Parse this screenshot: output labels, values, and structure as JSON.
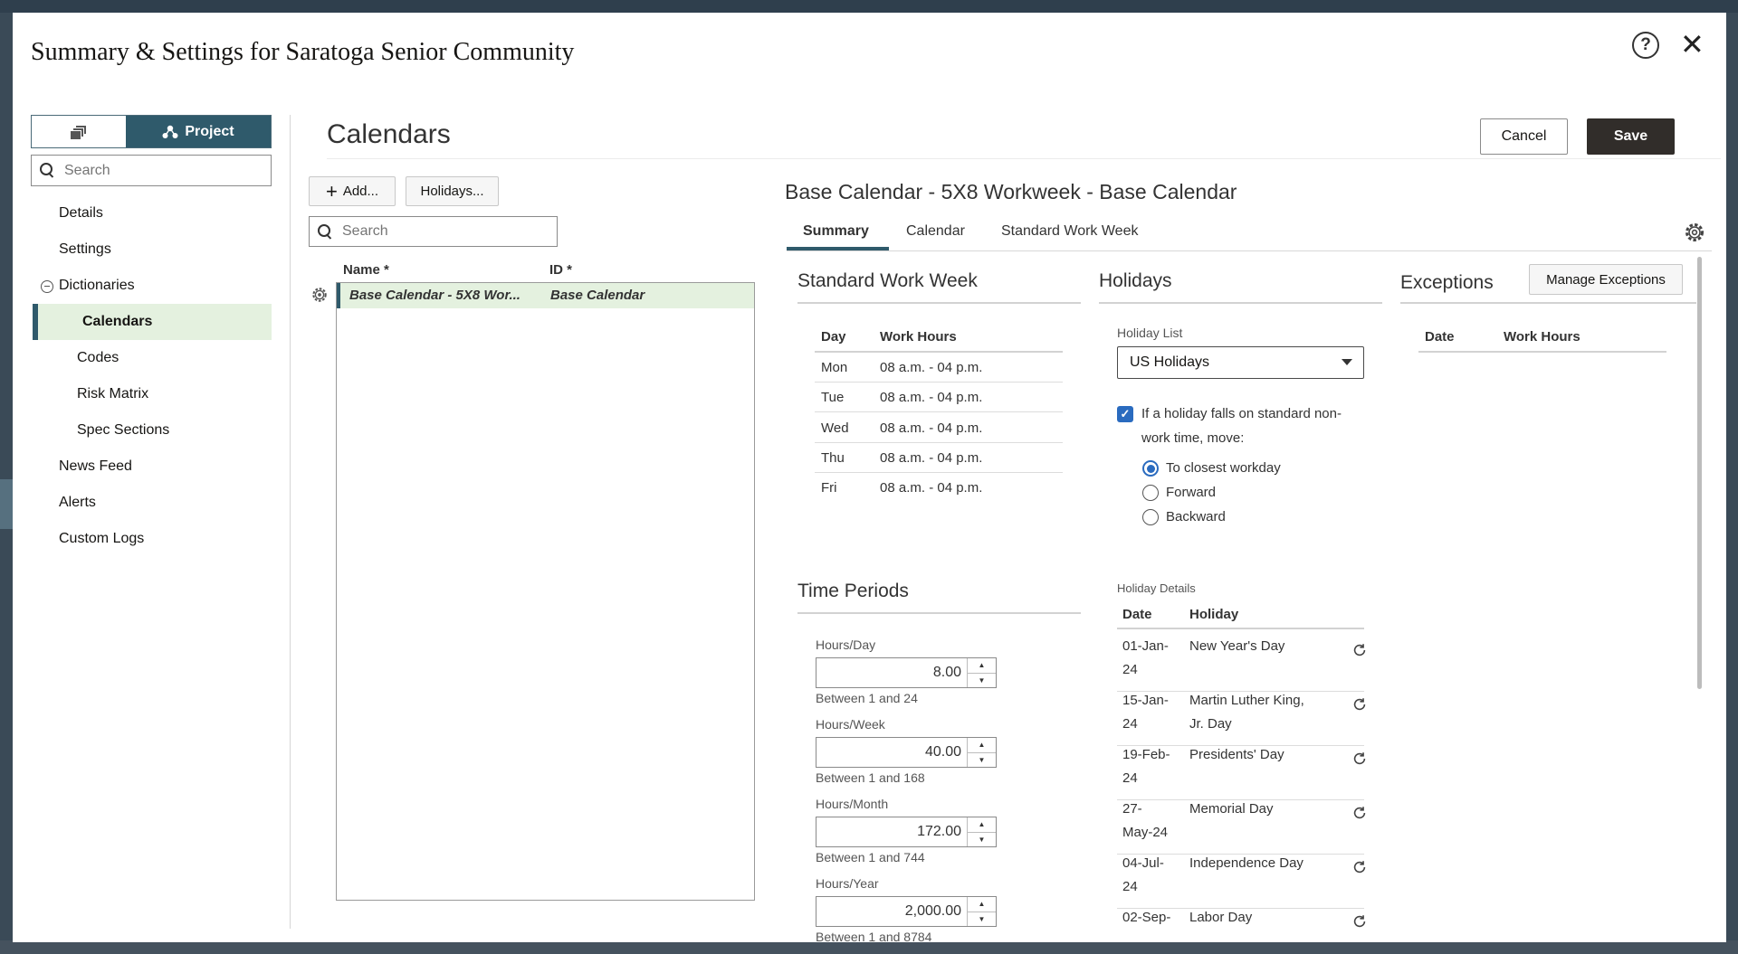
{
  "dialog": {
    "title": "Summary & Settings for Saratoga Senior Community"
  },
  "nav": {
    "toggle_project_label": "Project",
    "search_placeholder": "Search",
    "items": [
      {
        "label": "Details"
      },
      {
        "label": "Settings"
      },
      {
        "label": "Dictionaries"
      },
      {
        "label": "Calendars"
      },
      {
        "label": "Codes"
      },
      {
        "label": "Risk Matrix"
      },
      {
        "label": "Spec Sections"
      },
      {
        "label": "News Feed"
      },
      {
        "label": "Alerts"
      },
      {
        "label": "Custom Logs"
      }
    ]
  },
  "calendars": {
    "heading": "Calendars",
    "cancel_label": "Cancel",
    "save_label": "Save",
    "add_label": "Add...",
    "holidays_label": "Holidays...",
    "search_placeholder": "Search",
    "columns": {
      "name": "Name *",
      "id": "ID *"
    },
    "rows": [
      {
        "name": "Base Calendar - 5X8 Wor...",
        "id": "Base Calendar"
      }
    ]
  },
  "detail": {
    "title": "Base Calendar - 5X8 Workweek - Base Calendar",
    "tabs": [
      {
        "label": "Summary"
      },
      {
        "label": "Calendar"
      },
      {
        "label": "Standard Work Week"
      }
    ],
    "work_week": {
      "heading": "Standard Work Week",
      "col_day": "Day",
      "col_hours": "Work Hours",
      "rows": [
        {
          "day": "Mon",
          "hours": "08 a.m. - 04 p.m."
        },
        {
          "day": "Tue",
          "hours": "08 a.m. - 04 p.m."
        },
        {
          "day": "Wed",
          "hours": "08 a.m. - 04 p.m."
        },
        {
          "day": "Thu",
          "hours": "08 a.m. - 04 p.m."
        },
        {
          "day": "Fri",
          "hours": "08 a.m. - 04 p.m."
        }
      ]
    },
    "time_periods": {
      "heading": "Time Periods",
      "fields": [
        {
          "label": "Hours/Day",
          "value": "8.00",
          "hint": "Between 1 and 24"
        },
        {
          "label": "Hours/Week",
          "value": "40.00",
          "hint": "Between 1 and 168"
        },
        {
          "label": "Hours/Month",
          "value": "172.00",
          "hint": "Between 1 and 744"
        },
        {
          "label": "Hours/Year",
          "value": "2,000.00",
          "hint": "Between 1 and 8784"
        }
      ]
    },
    "holidays": {
      "heading": "Holidays",
      "list_label": "Holiday List",
      "list_value": "US Holidays",
      "move_line1": "If a holiday falls on standard non-",
      "move_line2": "work time, move:",
      "options": [
        {
          "label": "To closest workday"
        },
        {
          "label": "Forward"
        },
        {
          "label": "Backward"
        }
      ],
      "details_label": "Holiday Details",
      "col_date": "Date",
      "col_holiday": "Holiday",
      "rows": [
        {
          "date1": "01-Jan-",
          "date2": "24",
          "name1": "New Year's Day",
          "name2": ""
        },
        {
          "date1": "15-Jan-",
          "date2": "24",
          "name1": "Martin Luther King,",
          "name2": "Jr. Day"
        },
        {
          "date1": "19-Feb-",
          "date2": "24",
          "name1": "Presidents' Day",
          "name2": ""
        },
        {
          "date1": "27-",
          "date2": "May-24",
          "name1": "Memorial Day",
          "name2": ""
        },
        {
          "date1": "04-Jul-",
          "date2": "24",
          "name1": "Independence Day",
          "name2": ""
        },
        {
          "date1": "02-Sep-",
          "date2": "",
          "name1": "Labor Day",
          "name2": ""
        }
      ]
    },
    "exceptions": {
      "heading": "Exceptions",
      "manage_label": "Manage Exceptions",
      "col_date": "Date",
      "col_hours": "Work Hours"
    }
  },
  "colors": {
    "accent": "#2f5a6b",
    "selection": "#e4f1df",
    "primary_button": "#312d2a",
    "checkbox": "#2a6bbf"
  }
}
